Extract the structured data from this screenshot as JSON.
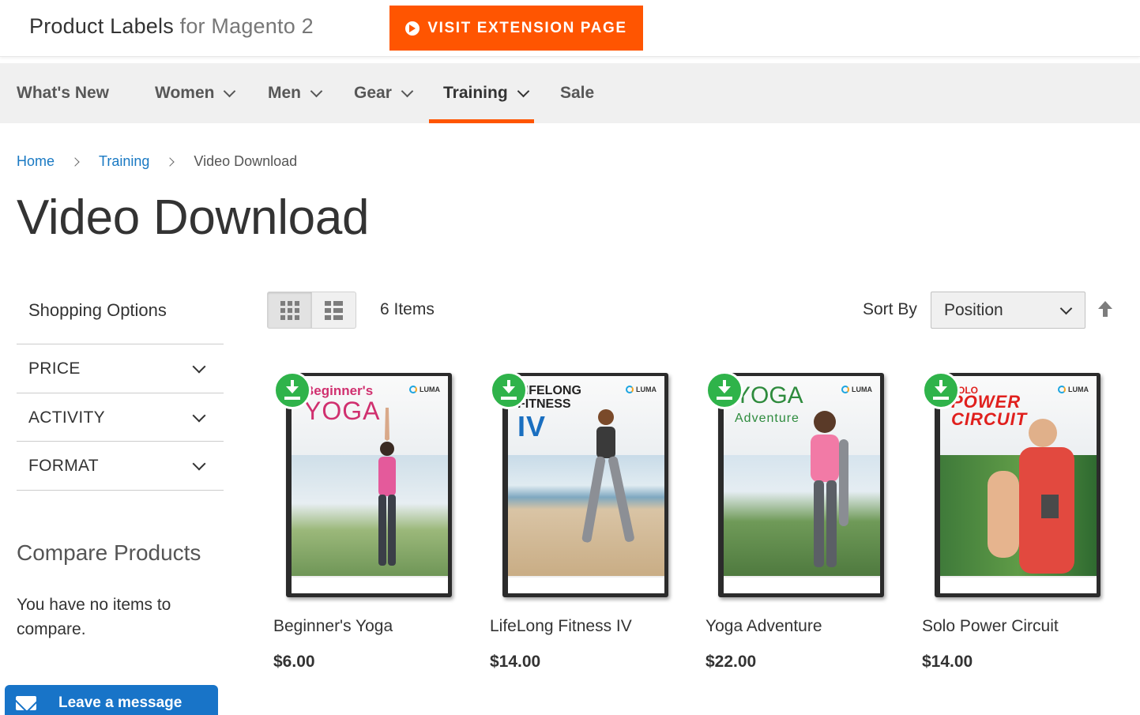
{
  "header": {
    "brand_main": "Product Labels",
    "brand_muted": "for Magento 2",
    "visit_button": "VISIT EXTENSION PAGE"
  },
  "nav": {
    "items": [
      "What's New",
      "Women",
      "Men",
      "Gear",
      "Training",
      "Sale"
    ],
    "active": "Training"
  },
  "breadcrumb": {
    "home": "Home",
    "training": "Training",
    "current": "Video Download"
  },
  "page_title": "Video Download",
  "sidebar": {
    "shopping_options": "Shopping Options",
    "filters": [
      "PRICE",
      "ACTIVITY",
      "FORMAT"
    ],
    "compare_title": "Compare Products",
    "compare_empty": "You have no items to compare."
  },
  "toolbar": {
    "items_count": "6 Items",
    "sort_label": "Sort By",
    "sort_value": "Position",
    "view_modes": [
      "grid",
      "list"
    ],
    "active_view": "grid"
  },
  "products": [
    {
      "name": "Beginner's Yoga",
      "price": "$6.00",
      "cover_line1": "Beginner's",
      "cover_line2": "YOGA",
      "cover_color": "#d0306f"
    },
    {
      "name": "LifeLong Fitness IV",
      "price": "$14.00",
      "cover_line1": "LIFELONG FITNESS",
      "cover_line2": "IV",
      "cover_color": "#1a6fc0"
    },
    {
      "name": "Yoga Adventure",
      "price": "$22.00",
      "cover_line1": "YOGA",
      "cover_line2": "Adventure",
      "cover_color": "#2e8b3d"
    },
    {
      "name": "Solo Power Circuit",
      "price": "$14.00",
      "cover_line1": "SOLO",
      "cover_line2": "POWER CIRCUIT",
      "cover_color": "#e0201d"
    }
  ],
  "cover_brand": "LUMA",
  "chat": {
    "label": "Leave a message"
  },
  "colors": {
    "accent": "#ff5501",
    "link": "#1979c3",
    "download_badge": "#2fb34a",
    "chat": "#1874c8"
  },
  "icons": {
    "visit": "play-circle-icon",
    "download": "download-icon",
    "chat": "envelope-icon",
    "sort_direction": "arrow-up-icon"
  }
}
